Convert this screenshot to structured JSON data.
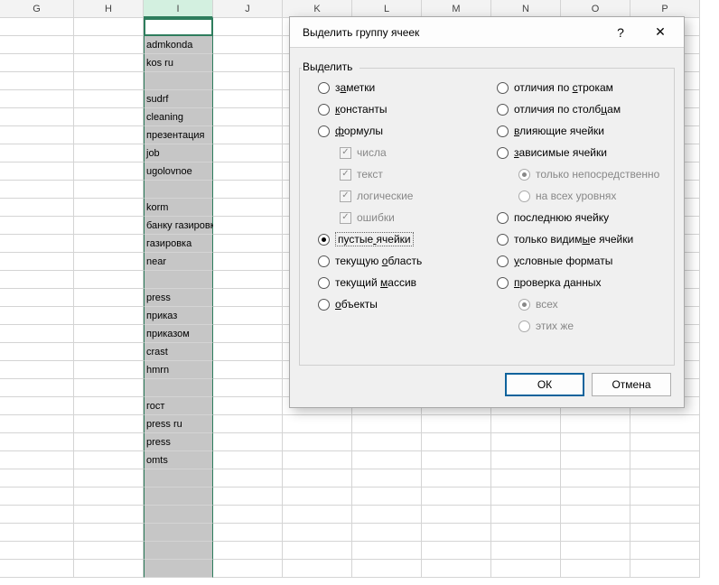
{
  "columns": [
    "G",
    "H",
    "I",
    "J",
    "K",
    "L",
    "M",
    "N",
    "O",
    "P"
  ],
  "selected_column": "I",
  "col_i_values": [
    "",
    "admkonda",
    "kos ru",
    "",
    "sudrf",
    "cleaning",
    "презентация",
    "job",
    "ugolovnoe",
    "",
    "korm",
    "банку газировки",
    "газировка",
    "near",
    "",
    "press",
    "приказ",
    "приказом",
    "crast",
    "hmrn",
    "",
    "гост",
    "press ru",
    "press",
    "omts",
    "",
    "",
    "",
    "",
    "",
    ""
  ],
  "dialog": {
    "title": "Выделить группу ячеек",
    "group_label": "Выделить",
    "help_tip": "?",
    "close_tip": "✕",
    "left_options": [
      {
        "kind": "radio",
        "label": "заметки",
        "u": 1,
        "checked": false
      },
      {
        "kind": "radio",
        "label": "константы",
        "u": 0,
        "checked": false
      },
      {
        "kind": "radio",
        "label": "формулы",
        "u": 0,
        "checked": false
      },
      {
        "kind": "check",
        "label": "числа",
        "indent": true,
        "disabled": true
      },
      {
        "kind": "check",
        "label": "текст",
        "indent": true,
        "disabled": true
      },
      {
        "kind": "check",
        "label": "логические",
        "indent": true,
        "disabled": true
      },
      {
        "kind": "check",
        "label": "ошибки",
        "indent": true,
        "disabled": true
      },
      {
        "kind": "radio",
        "label": "пустые ячейки",
        "u": 6,
        "checked": true,
        "focused": true
      },
      {
        "kind": "radio",
        "label": "текущую область",
        "u": 8,
        "checked": false
      },
      {
        "kind": "radio",
        "label": "текущий массив",
        "u": 8,
        "checked": false
      },
      {
        "kind": "radio",
        "label": "объекты",
        "u": 0,
        "checked": false
      }
    ],
    "right_options": [
      {
        "kind": "radio",
        "label": "отличия по строкам",
        "u": 11,
        "checked": false
      },
      {
        "kind": "radio",
        "label": "отличия по столбцам",
        "u": 16,
        "checked": false
      },
      {
        "kind": "radio",
        "label": "влияющие ячейки",
        "u": 0,
        "checked": false
      },
      {
        "kind": "radio",
        "label": "зависимые ячейки",
        "u": 0,
        "checked": false
      },
      {
        "kind": "radio",
        "label": "только непосредственно",
        "indent": true,
        "disabled": true,
        "checked": true
      },
      {
        "kind": "radio",
        "label": "на всех уровнях",
        "indent": true,
        "disabled": true,
        "checked": false
      },
      {
        "kind": "radio",
        "label": "последнюю ячейку",
        "u": 5,
        "checked": false
      },
      {
        "kind": "radio",
        "label": "только видимые ячейки",
        "u": 12,
        "checked": false
      },
      {
        "kind": "radio",
        "label": "условные форматы",
        "u": 0,
        "checked": false
      },
      {
        "kind": "radio",
        "label": "проверка данных",
        "u": 0,
        "checked": false
      },
      {
        "kind": "radio",
        "label": "всех",
        "indent": true,
        "disabled": true,
        "checked": true
      },
      {
        "kind": "radio",
        "label": "этих же",
        "indent": true,
        "disabled": true,
        "checked": false
      }
    ],
    "ok_label": "ОК",
    "cancel_label": "Отмена"
  }
}
